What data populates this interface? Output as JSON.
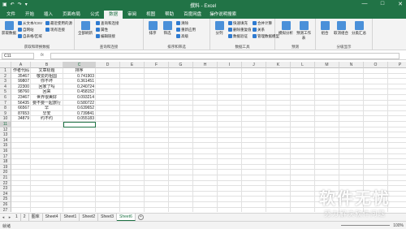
{
  "title_bar": {
    "title": "撰料 - Excel",
    "qa_icons": [
      "save-icon",
      "undo-icon",
      "redo-icon",
      "customize-icon"
    ],
    "win_buttons": [
      "—",
      "□",
      "✕"
    ]
  },
  "tabs": [
    "文件",
    "开始",
    "插入",
    "页面布局",
    "公式",
    "数据",
    "审阅",
    "视图",
    "帮助",
    "百度网盘"
  ],
  "active_tab": "数据",
  "tell_me": "操作说明搜索",
  "ribbon": {
    "get_data": "获取数据",
    "from_csv": "从文本/CSV",
    "from_web": "自网站",
    "from_table": "自表格/区域",
    "recent_sources": "最近使用的源",
    "existing_conn": "现有连接",
    "group1": "获取和转换数据",
    "refresh_all": "全部刷新",
    "queries_conn": "查询和连接",
    "properties": "属性",
    "edit_links": "编辑链接",
    "group2": "查询和连接",
    "sort": "排序",
    "filter": "筛选",
    "clear": "清除",
    "reapply": "重新应用",
    "advanced": "高级",
    "group3": "排序和筛选",
    "text_to_col": "分列",
    "flash_fill": "快速填充",
    "remove_dup": "删除重复值",
    "validation": "数据验证",
    "consolidate": "合并计算",
    "relationships": "关系",
    "data_model": "管理数据模型",
    "group4": "数据工具",
    "what_if": "模拟分析",
    "forecast": "预测工作表",
    "group5": "预测",
    "group_btn": "组合",
    "ungroup": "取消组合",
    "subtotal": "分类汇总",
    "group6": "分级显示"
  },
  "name_box": "C11",
  "fx": "fx",
  "columns": [
    "A",
    "B",
    "C",
    "D",
    "E",
    "F",
    "G",
    "H",
    "I",
    "J",
    "K",
    "L",
    "M",
    "N",
    "O",
    "P"
  ],
  "rows": [
    {
      "num": "1",
      "a": "作者代码",
      "b": "文章标题",
      "c": "排序"
    },
    {
      "num": "2",
      "a": "35467",
      "b": "敬爱的祖国",
      "c": "0.741903"
    },
    {
      "num": "3",
      "a": "99807",
      "b": "你不坏",
      "c": "0.361451"
    },
    {
      "num": "4",
      "a": "22300",
      "b": "回家了吗",
      "c": "0.240724"
    },
    {
      "num": "5",
      "a": "98760",
      "b": "回来",
      "c": "0.458152"
    },
    {
      "num": "6",
      "a": "23467",
      "b": "世界很美好",
      "c": "0.093214"
    },
    {
      "num": "7",
      "a": "56435",
      "b": "要不要一起旅行",
      "c": "0.580722"
    },
    {
      "num": "8",
      "a": "66567",
      "b": "早",
      "c": "0.639652"
    },
    {
      "num": "9",
      "a": "87653",
      "b": "早安",
      "c": "0.739841"
    },
    {
      "num": "10",
      "a": "34879",
      "b": "约不约",
      "c": "0.055183"
    },
    {
      "num": "11",
      "a": "",
      "b": "",
      "c": ""
    },
    {
      "num": "12",
      "a": "",
      "b": "",
      "c": ""
    },
    {
      "num": "13",
      "a": "",
      "b": "",
      "c": ""
    },
    {
      "num": "14",
      "a": "",
      "b": "",
      "c": ""
    },
    {
      "num": "15",
      "a": "",
      "b": "",
      "c": ""
    },
    {
      "num": "16",
      "a": "",
      "b": "",
      "c": ""
    },
    {
      "num": "17",
      "a": "",
      "b": "",
      "c": ""
    },
    {
      "num": "18",
      "a": "",
      "b": "",
      "c": ""
    },
    {
      "num": "19",
      "a": "",
      "b": "",
      "c": ""
    },
    {
      "num": "20",
      "a": "",
      "b": "",
      "c": ""
    },
    {
      "num": "21",
      "a": "",
      "b": "",
      "c": ""
    },
    {
      "num": "22",
      "a": "",
      "b": "",
      "c": ""
    },
    {
      "num": "23",
      "a": "",
      "b": "",
      "c": ""
    },
    {
      "num": "24",
      "a": "",
      "b": "",
      "c": ""
    },
    {
      "num": "25",
      "a": "",
      "b": "",
      "c": ""
    },
    {
      "num": "26",
      "a": "",
      "b": "",
      "c": ""
    },
    {
      "num": "27",
      "a": "",
      "b": "",
      "c": ""
    }
  ],
  "sheet_tabs": [
    "1",
    "2",
    "图库",
    "Sheet4",
    "Sheet1",
    "Sheet2",
    "Sheet3",
    "Sheet6"
  ],
  "active_sheet": "Sheet6",
  "status": {
    "ready": "就绪",
    "zoom": "100%"
  },
  "watermark": {
    "line1": "软件无忧",
    "line2": "努力解决软件问题"
  },
  "colors": {
    "accent": "#217346",
    "ribbon": "#f3f3f3"
  }
}
